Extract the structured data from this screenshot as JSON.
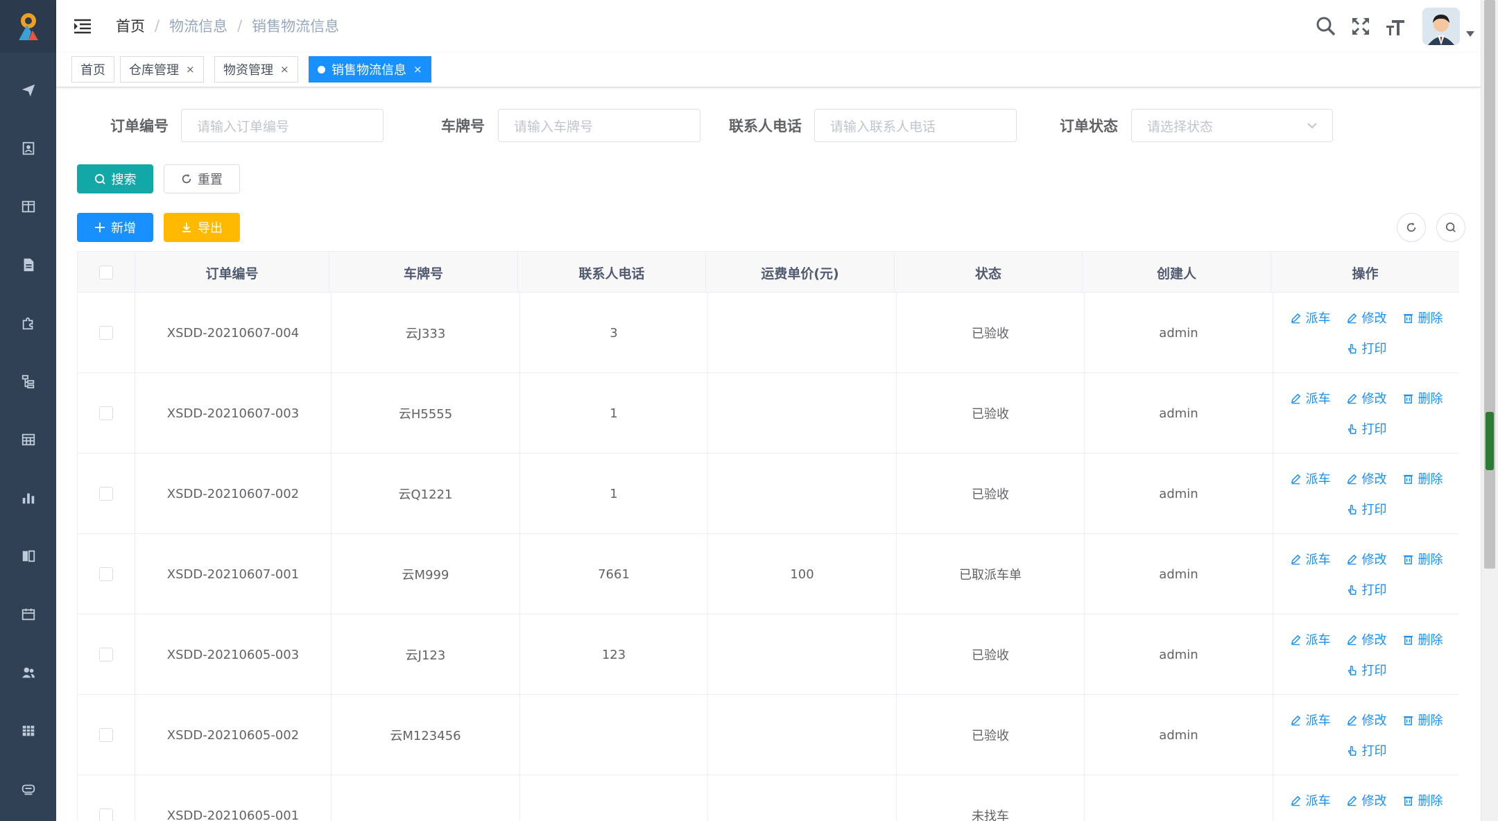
{
  "breadcrumb": [
    "首页",
    "物流信息",
    "销售物流信息"
  ],
  "breadcrumb_separator": "/",
  "tags": [
    {
      "label": "首页",
      "closable": false,
      "active": false
    },
    {
      "label": "仓库管理",
      "closable": true,
      "active": false
    },
    {
      "label": "物资管理",
      "closable": true,
      "active": false
    },
    {
      "label": "销售物流信息",
      "closable": true,
      "active": true
    }
  ],
  "tag_close_glyph": "×",
  "filters": {
    "order_no": {
      "label": "订单编号",
      "placeholder": "请输入订单编号"
    },
    "plate": {
      "label": "车牌号",
      "placeholder": "请输入车牌号"
    },
    "phone": {
      "label": "联系人电话",
      "placeholder": "请输入联系人电话"
    },
    "status": {
      "label": "订单状态",
      "placeholder": "请选择状态"
    }
  },
  "buttons": {
    "search": "搜索",
    "reset": "重置",
    "add": "新增",
    "export": "导出"
  },
  "table": {
    "columns": [
      "订单编号",
      "车牌号",
      "联系人电话",
      "运费单价(元)",
      "状态",
      "创建人",
      "操作"
    ],
    "actions": {
      "dispatch": "派车",
      "edit": "修改",
      "delete": "删除",
      "print": "打印"
    },
    "rows": [
      {
        "order_no": "XSDD-20210607-004",
        "plate": "云J333",
        "phone": "3",
        "price": "",
        "status": "已验收",
        "creator": "admin"
      },
      {
        "order_no": "XSDD-20210607-003",
        "plate": "云H5555",
        "phone": "1",
        "price": "",
        "status": "已验收",
        "creator": "admin"
      },
      {
        "order_no": "XSDD-20210607-002",
        "plate": "云Q1221",
        "phone": "1",
        "price": "",
        "status": "已验收",
        "creator": "admin"
      },
      {
        "order_no": "XSDD-20210607-001",
        "plate": "云M999",
        "phone": "7661",
        "price": "100",
        "status": "已取派车单",
        "creator": "admin"
      },
      {
        "order_no": "XSDD-20210605-003",
        "plate": "云J123",
        "phone": "123",
        "price": "",
        "status": "已验收",
        "creator": "admin"
      },
      {
        "order_no": "XSDD-20210605-002",
        "plate": "云M123456",
        "phone": "",
        "price": "",
        "status": "已验收",
        "creator": "admin"
      },
      {
        "order_no": "XSDD-20210605-001",
        "plate": "",
        "phone": "",
        "price": "",
        "status": "未找车",
        "creator": ""
      }
    ]
  },
  "sidebar_icons": [
    "logo-icon",
    "send-icon",
    "contact-icon",
    "layout-icon",
    "document-icon",
    "puzzle-icon",
    "tree-icon",
    "table-icon",
    "chart-icon",
    "book-icon",
    "calendar-icon",
    "users-icon",
    "grid-icon",
    "monitor-icon"
  ],
  "colors": {
    "sidebar": "#304156",
    "primary": "#1890ff",
    "search": "#13a8a8",
    "export": "#ffba00",
    "header_bg": "#f8f8f9"
  }
}
